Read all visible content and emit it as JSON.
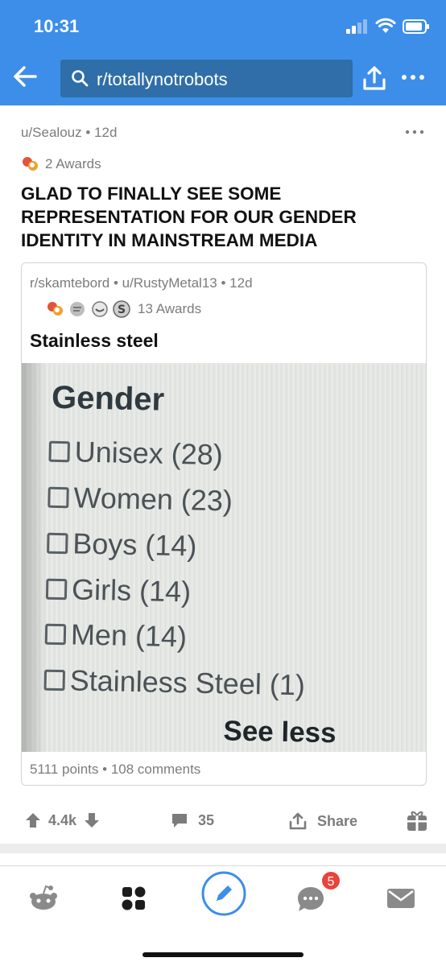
{
  "status_bar": {
    "time": "10:31"
  },
  "header": {
    "search_text": "r/totallynotrobots"
  },
  "post": {
    "author": "u/Sealouz",
    "age": "12d",
    "awards_text": "2 Awards",
    "title": "GLAD TO FINALLY SEE SOME REPRESENTATION FOR OUR GENDER IDENTITY IN MAINSTREAM MEDIA"
  },
  "crosspost": {
    "subreddit": "r/skamtebord",
    "author": "u/RustyMetal13",
    "age": "12d",
    "awards_text": "13 Awards",
    "title": "Stainless steel",
    "image": {
      "heading": "Gender",
      "options": [
        "Unisex (28)",
        "Women (23)",
        "Boys (14)",
        "Girls (14)",
        "Men (14)",
        "Stainless Steel (1)"
      ],
      "see_less": "See less"
    },
    "points": "5111 points",
    "comments": "108 comments"
  },
  "actions": {
    "votes": "4.4k",
    "comments": "35",
    "share": "Share"
  },
  "nav": {
    "inbox_badge": "5"
  },
  "colors": {
    "header_bg": "#3d8ee8",
    "accent": "#3d8ee8",
    "badge": "#e8443a"
  }
}
